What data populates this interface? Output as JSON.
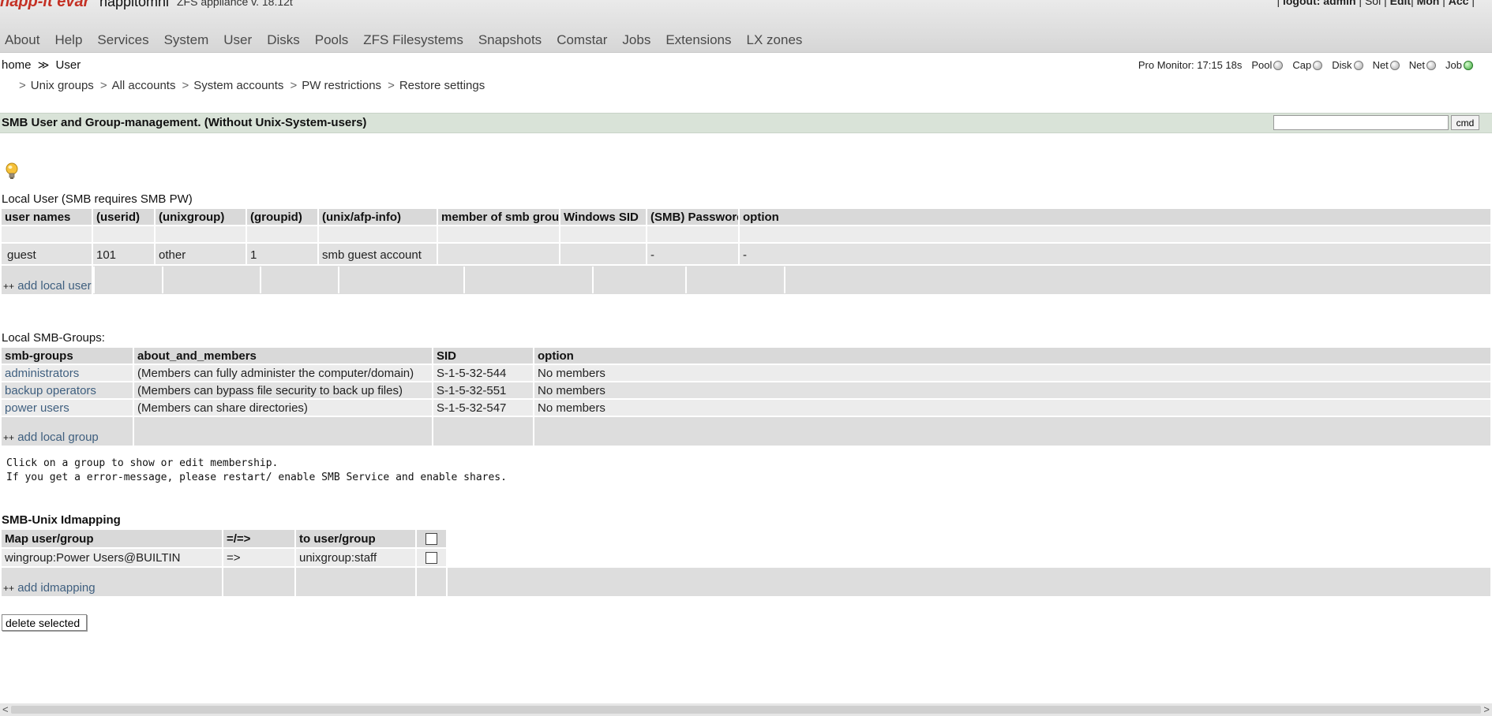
{
  "header": {
    "logo": "napp-it evar",
    "hostname": "nappitomni",
    "version": "ZFS appliance v. 18.12t",
    "user_links": [
      {
        "prefix": "| ",
        "label": "logout: admin",
        "bold": true
      },
      {
        "prefix": " | ",
        "label": "Sol",
        "bold": false
      },
      {
        "prefix": " | ",
        "label": "Edit",
        "bold": true
      },
      {
        "prefix": "| ",
        "label": "Mon",
        "bold": true
      },
      {
        "prefix": " | ",
        "label": "Acc",
        "bold": true
      },
      {
        "prefix": " ",
        "label": "|",
        "bold": false
      }
    ]
  },
  "menu": [
    "About",
    "Help",
    "Services",
    "System",
    "User",
    "Disks",
    "Pools",
    "ZFS Filesystems",
    "Snapshots",
    "Comstar",
    "Jobs",
    "Extensions",
    "LX zones"
  ],
  "breadcrumb": {
    "home": "home",
    "sep": "≫",
    "current": "User"
  },
  "monitor": {
    "label": "Pro Monitor: 17:15 18s",
    "items": [
      {
        "label": "Pool",
        "status": "off"
      },
      {
        "label": "Cap",
        "status": "off"
      },
      {
        "label": "Disk",
        "status": "off"
      },
      {
        "label": "Net",
        "status": "off"
      },
      {
        "label": "Net",
        "status": "off"
      },
      {
        "label": "Job",
        "status": "on"
      }
    ]
  },
  "submenu": [
    "Unix groups",
    "All accounts",
    "System accounts",
    "PW restrictions",
    "Restore settings"
  ],
  "titlebar": {
    "title": "SMB User and Group-management. (Without Unix-System-users)",
    "cmd_value": "",
    "cmd_label": "cmd"
  },
  "icons": {
    "hint": "lightbulb-icon"
  },
  "local_users": {
    "label": "Local User (SMB requires SMB PW)",
    "columns": [
      "user names",
      "(userid)",
      "(unixgroup)",
      "(groupid)",
      "(unix/afp-info)",
      "member of smb group",
      "Windows SID",
      "(SMB) Password",
      "option"
    ],
    "rows": [
      [
        "",
        "",
        "",
        "",
        "",
        "",
        "",
        "",
        ""
      ],
      [
        "guest",
        "101",
        "other",
        "1",
        "smb guest account",
        "",
        "",
        "-",
        "-"
      ]
    ],
    "add_prefix": "++",
    "add_label": "add local user"
  },
  "smb_groups": {
    "label": "Local SMB-Groups:",
    "columns": [
      "smb-groups",
      "about_and_members",
      "SID",
      "option"
    ],
    "rows": [
      {
        "name": "administrators",
        "about": "(Members can fully administer the computer/domain)",
        "sid": "S-1-5-32-544",
        "option": "No members"
      },
      {
        "name": "backup operators",
        "about": "(Members can bypass file security to back up files)",
        "sid": "S-1-5-32-551",
        "option": "No members"
      },
      {
        "name": "power users",
        "about": "(Members can share directories)",
        "sid": "S-1-5-32-547",
        "option": "No members"
      }
    ],
    "add_prefix": "++",
    "add_label": "add local group"
  },
  "note": "Click on a group to show or edit membership.\nIf you get a error-message, please restart/ enable SMB Service and enable shares.",
  "idmapping": {
    "label": "SMB-Unix Idmapping",
    "columns": [
      "Map user/group",
      "=/=>",
      "to user/group"
    ],
    "rows": [
      {
        "from": "wingroup:Power Users@BUILTIN",
        "arrow": "=>",
        "to": "unixgroup:staff"
      }
    ],
    "add_prefix": "++",
    "add_label": "add idmapping"
  },
  "delete_button": "delete selected"
}
